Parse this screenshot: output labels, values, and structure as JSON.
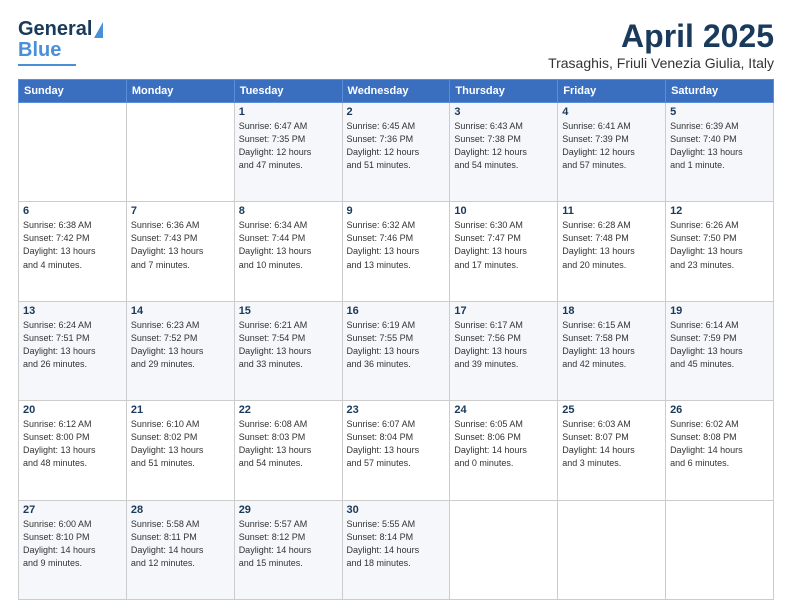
{
  "logo": {
    "line1": "General",
    "line2": "Blue"
  },
  "header": {
    "title": "April 2025",
    "subtitle": "Trasaghis, Friuli Venezia Giulia, Italy"
  },
  "weekdays": [
    "Sunday",
    "Monday",
    "Tuesday",
    "Wednesday",
    "Thursday",
    "Friday",
    "Saturday"
  ],
  "weeks": [
    [
      {
        "day": "",
        "info": ""
      },
      {
        "day": "",
        "info": ""
      },
      {
        "day": "1",
        "info": "Sunrise: 6:47 AM\nSunset: 7:35 PM\nDaylight: 12 hours\nand 47 minutes."
      },
      {
        "day": "2",
        "info": "Sunrise: 6:45 AM\nSunset: 7:36 PM\nDaylight: 12 hours\nand 51 minutes."
      },
      {
        "day": "3",
        "info": "Sunrise: 6:43 AM\nSunset: 7:38 PM\nDaylight: 12 hours\nand 54 minutes."
      },
      {
        "day": "4",
        "info": "Sunrise: 6:41 AM\nSunset: 7:39 PM\nDaylight: 12 hours\nand 57 minutes."
      },
      {
        "day": "5",
        "info": "Sunrise: 6:39 AM\nSunset: 7:40 PM\nDaylight: 13 hours\nand 1 minute."
      }
    ],
    [
      {
        "day": "6",
        "info": "Sunrise: 6:38 AM\nSunset: 7:42 PM\nDaylight: 13 hours\nand 4 minutes."
      },
      {
        "day": "7",
        "info": "Sunrise: 6:36 AM\nSunset: 7:43 PM\nDaylight: 13 hours\nand 7 minutes."
      },
      {
        "day": "8",
        "info": "Sunrise: 6:34 AM\nSunset: 7:44 PM\nDaylight: 13 hours\nand 10 minutes."
      },
      {
        "day": "9",
        "info": "Sunrise: 6:32 AM\nSunset: 7:46 PM\nDaylight: 13 hours\nand 13 minutes."
      },
      {
        "day": "10",
        "info": "Sunrise: 6:30 AM\nSunset: 7:47 PM\nDaylight: 13 hours\nand 17 minutes."
      },
      {
        "day": "11",
        "info": "Sunrise: 6:28 AM\nSunset: 7:48 PM\nDaylight: 13 hours\nand 20 minutes."
      },
      {
        "day": "12",
        "info": "Sunrise: 6:26 AM\nSunset: 7:50 PM\nDaylight: 13 hours\nand 23 minutes."
      }
    ],
    [
      {
        "day": "13",
        "info": "Sunrise: 6:24 AM\nSunset: 7:51 PM\nDaylight: 13 hours\nand 26 minutes."
      },
      {
        "day": "14",
        "info": "Sunrise: 6:23 AM\nSunset: 7:52 PM\nDaylight: 13 hours\nand 29 minutes."
      },
      {
        "day": "15",
        "info": "Sunrise: 6:21 AM\nSunset: 7:54 PM\nDaylight: 13 hours\nand 33 minutes."
      },
      {
        "day": "16",
        "info": "Sunrise: 6:19 AM\nSunset: 7:55 PM\nDaylight: 13 hours\nand 36 minutes."
      },
      {
        "day": "17",
        "info": "Sunrise: 6:17 AM\nSunset: 7:56 PM\nDaylight: 13 hours\nand 39 minutes."
      },
      {
        "day": "18",
        "info": "Sunrise: 6:15 AM\nSunset: 7:58 PM\nDaylight: 13 hours\nand 42 minutes."
      },
      {
        "day": "19",
        "info": "Sunrise: 6:14 AM\nSunset: 7:59 PM\nDaylight: 13 hours\nand 45 minutes."
      }
    ],
    [
      {
        "day": "20",
        "info": "Sunrise: 6:12 AM\nSunset: 8:00 PM\nDaylight: 13 hours\nand 48 minutes."
      },
      {
        "day": "21",
        "info": "Sunrise: 6:10 AM\nSunset: 8:02 PM\nDaylight: 13 hours\nand 51 minutes."
      },
      {
        "day": "22",
        "info": "Sunrise: 6:08 AM\nSunset: 8:03 PM\nDaylight: 13 hours\nand 54 minutes."
      },
      {
        "day": "23",
        "info": "Sunrise: 6:07 AM\nSunset: 8:04 PM\nDaylight: 13 hours\nand 57 minutes."
      },
      {
        "day": "24",
        "info": "Sunrise: 6:05 AM\nSunset: 8:06 PM\nDaylight: 14 hours\nand 0 minutes."
      },
      {
        "day": "25",
        "info": "Sunrise: 6:03 AM\nSunset: 8:07 PM\nDaylight: 14 hours\nand 3 minutes."
      },
      {
        "day": "26",
        "info": "Sunrise: 6:02 AM\nSunset: 8:08 PM\nDaylight: 14 hours\nand 6 minutes."
      }
    ],
    [
      {
        "day": "27",
        "info": "Sunrise: 6:00 AM\nSunset: 8:10 PM\nDaylight: 14 hours\nand 9 minutes."
      },
      {
        "day": "28",
        "info": "Sunrise: 5:58 AM\nSunset: 8:11 PM\nDaylight: 14 hours\nand 12 minutes."
      },
      {
        "day": "29",
        "info": "Sunrise: 5:57 AM\nSunset: 8:12 PM\nDaylight: 14 hours\nand 15 minutes."
      },
      {
        "day": "30",
        "info": "Sunrise: 5:55 AM\nSunset: 8:14 PM\nDaylight: 14 hours\nand 18 minutes."
      },
      {
        "day": "",
        "info": ""
      },
      {
        "day": "",
        "info": ""
      },
      {
        "day": "",
        "info": ""
      }
    ]
  ]
}
